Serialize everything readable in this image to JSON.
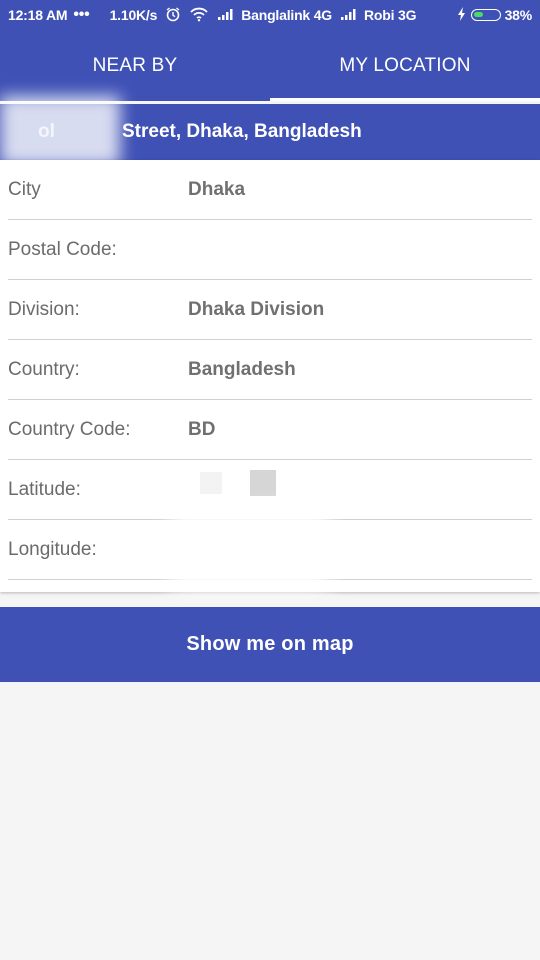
{
  "status_bar": {
    "time": "12:18 AM",
    "overflow": "•••",
    "speed": "1.10K/s",
    "carrier1": "Banglalink 4G",
    "carrier2": "Robi 3G",
    "battery": "38%",
    "icons": [
      "alarm-icon",
      "wifi-icon",
      "signal-icon",
      "charging-icon",
      "battery-icon"
    ]
  },
  "tabs": [
    {
      "label": "NEAR BY",
      "active": false
    },
    {
      "label": "MY LOCATION",
      "active": true
    }
  ],
  "address": {
    "prefix": "ol",
    "text": "Street, Dhaka, Bangladesh"
  },
  "details": [
    {
      "label": "City",
      "value": "Dhaka"
    },
    {
      "label": "Postal Code:",
      "value": ""
    },
    {
      "label": "Division:",
      "value": "Dhaka Division"
    },
    {
      "label": "Country:",
      "value": "Bangladesh"
    },
    {
      "label": "Country Code:",
      "value": "BD"
    },
    {
      "label": "Latitude:",
      "value": ""
    },
    {
      "label": "Longitude:",
      "value": ""
    }
  ],
  "map_button": {
    "label": "Show me on map"
  },
  "colors": {
    "primary": "#3f51b5",
    "background": "#f5f5f5"
  }
}
